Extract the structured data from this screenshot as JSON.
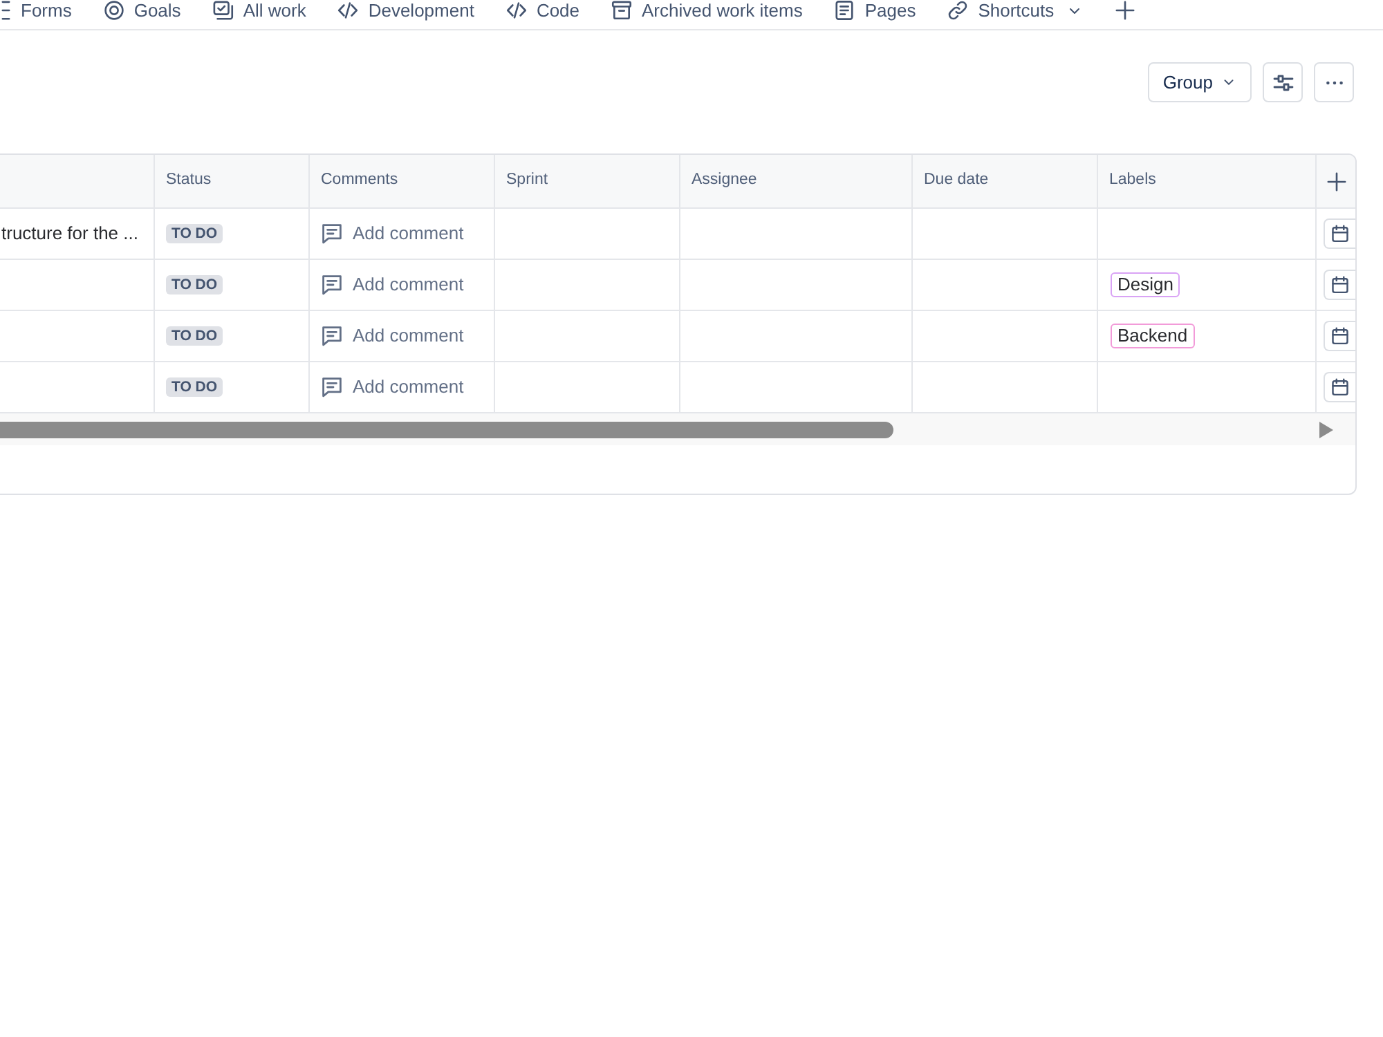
{
  "nav_tabs": [
    {
      "label": "Forms",
      "kind": "forms",
      "dropdown": false
    },
    {
      "label": "Goals",
      "kind": "goals",
      "dropdown": false
    },
    {
      "label": "All work",
      "kind": "checklist",
      "dropdown": false
    },
    {
      "label": "Development",
      "kind": "code",
      "dropdown": false
    },
    {
      "label": "Code",
      "kind": "code",
      "dropdown": false
    },
    {
      "label": "Archived work items",
      "kind": "archive",
      "dropdown": false
    },
    {
      "label": "Pages",
      "kind": "page",
      "dropdown": false
    },
    {
      "label": "Shortcuts",
      "kind": "link",
      "dropdown": true
    }
  ],
  "toolbar": {
    "group_button": {
      "label": "Group"
    }
  },
  "table": {
    "columns": [
      {
        "label": "Status"
      },
      {
        "label": "Comments"
      },
      {
        "label": "Sprint"
      },
      {
        "label": "Assignee"
      },
      {
        "label": "Due date"
      },
      {
        "label": "Labels"
      }
    ],
    "rows": [
      {
        "column_1": "tructure for the ...",
        "status": "TO DO",
        "comments": "Add comment"
      },
      {
        "status": "TO DO",
        "comments": "Add comment",
        "labels": [
          {
            "text": "Design",
            "color": "#d9a3f5"
          }
        ]
      },
      {
        "status": "TO DO",
        "comments": "Add comment",
        "labels": [
          {
            "text": "Backend",
            "color": "#f29bd9"
          }
        ]
      },
      {
        "status": "TO DO",
        "comments": "Add comment"
      }
    ]
  }
}
